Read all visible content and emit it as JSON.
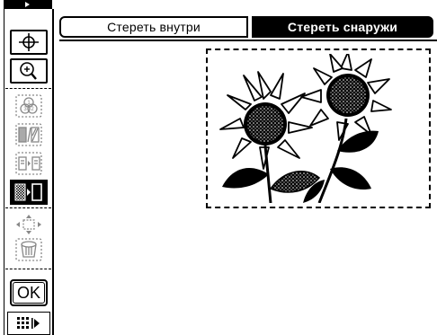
{
  "tabs": {
    "erase_inside": "Стереть внутри",
    "erase_outside": "Стереть снаружи",
    "active": "erase_outside"
  },
  "toolbar": {
    "ok_label": "OK",
    "items": [
      {
        "name": "move-crosshair",
        "state": "active"
      },
      {
        "name": "zoom",
        "state": "active"
      },
      {
        "name": "multi-page",
        "state": "disabled"
      },
      {
        "name": "invert",
        "state": "disabled"
      },
      {
        "name": "copy-page",
        "state": "disabled"
      },
      {
        "name": "erase-outside-mode",
        "state": "selected"
      },
      {
        "name": "position",
        "state": "disabled"
      },
      {
        "name": "trash",
        "state": "disabled"
      }
    ]
  },
  "colors": {
    "foreground": "#000000",
    "background": "#ffffff"
  }
}
